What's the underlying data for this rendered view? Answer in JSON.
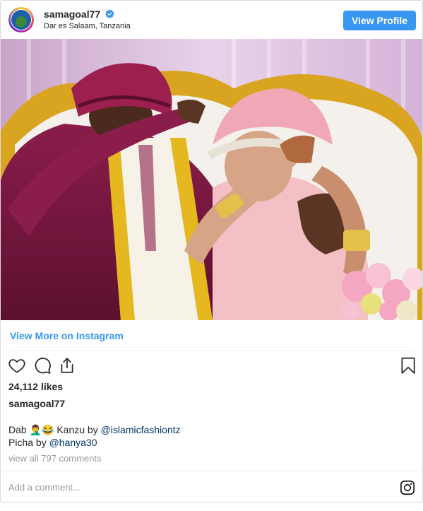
{
  "header": {
    "username": "samagoal77",
    "location": "Dar es Salaam, Tanzania",
    "view_profile_label": "View Profile"
  },
  "post": {
    "image_alt": "Wedding couple dabbing",
    "view_more_label": "View More on Instagram",
    "likes": "24,112 likes",
    "owner": "samagoal77",
    "caption_line1_text": "Dab 🤦‍♂️😂 Kanzu by ",
    "caption_line1_mention": "@islamicfashiontz",
    "caption_line2_text": "Picha by ",
    "caption_line2_mention": "@hanya30",
    "view_comments": "view all 797 comments",
    "add_comment_placeholder": "Add a comment..."
  },
  "colors": {
    "accent": "#3897f0",
    "mention": "#003569",
    "muted": "#999999"
  },
  "icons": [
    "verified-badge-icon",
    "heart-icon",
    "comment-icon",
    "share-icon",
    "bookmark-icon",
    "instagram-logo-icon"
  ]
}
